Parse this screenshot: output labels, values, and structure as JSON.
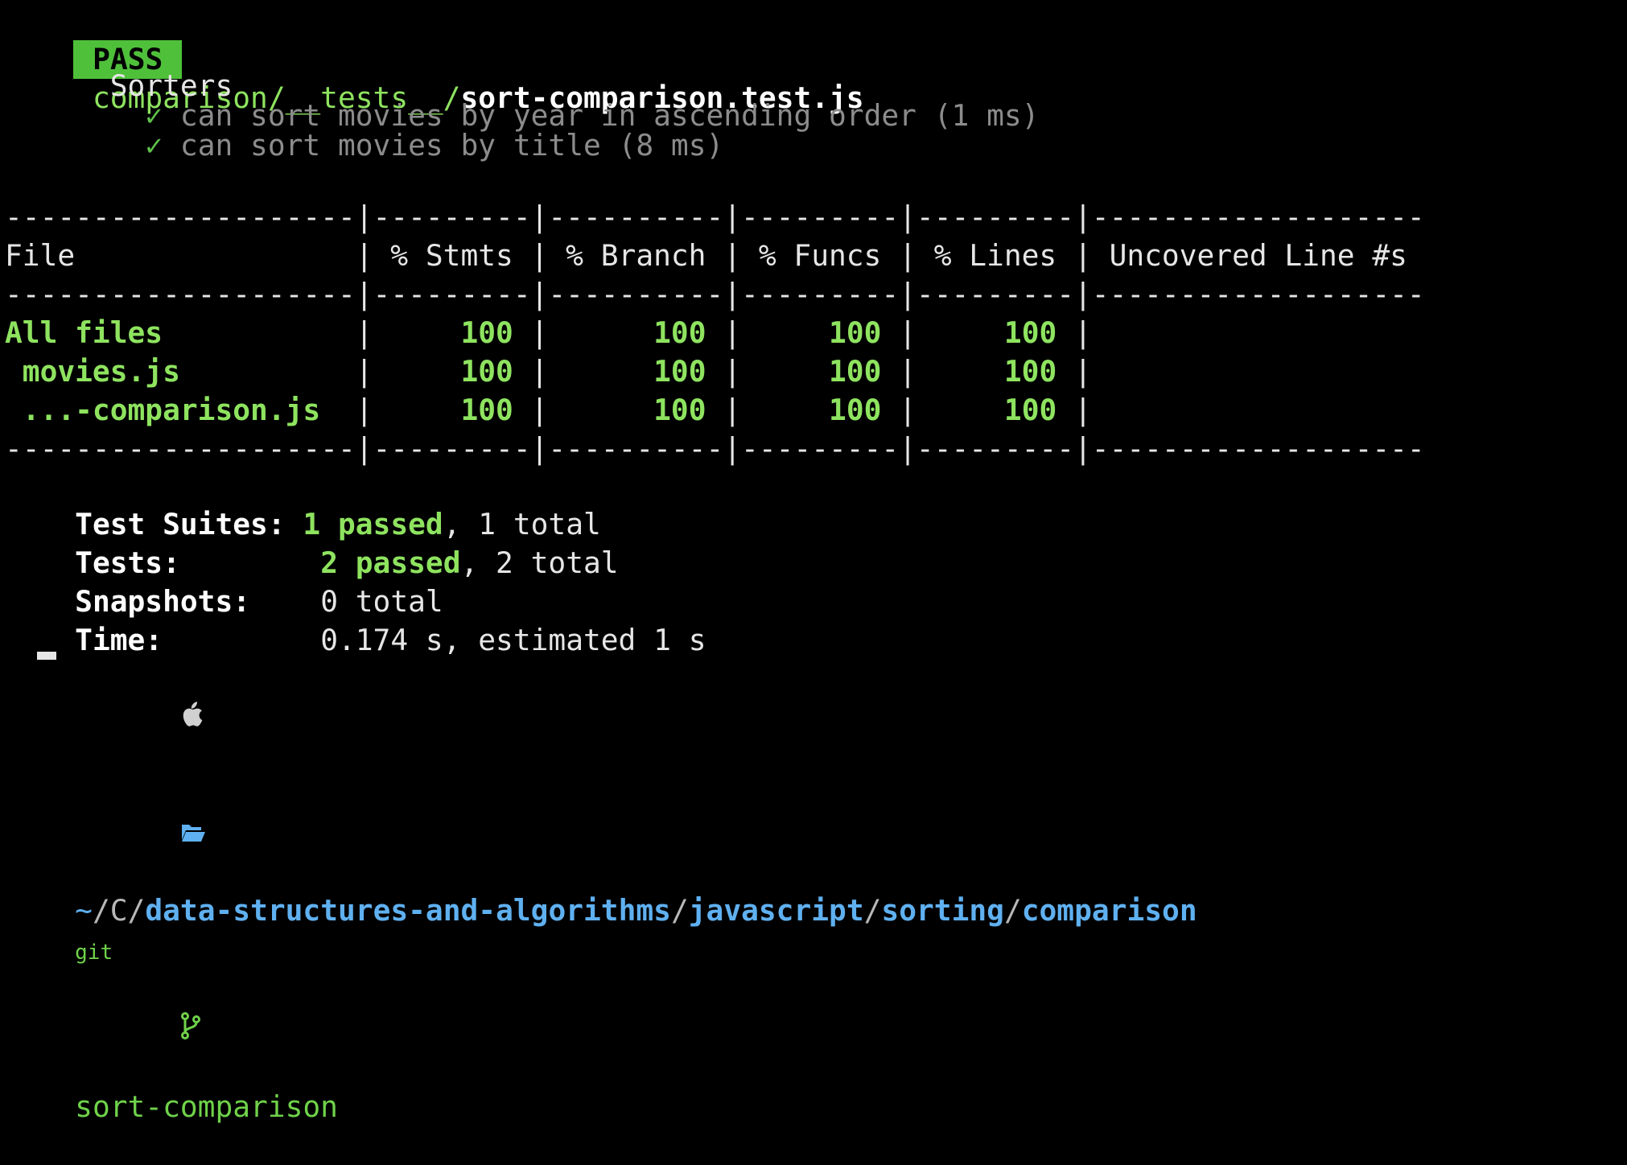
{
  "test_file": {
    "badge": "PASS",
    "dir": "comparison/__tests__/",
    "file": "sort-comparison.test.js"
  },
  "suite": {
    "name": "Sorters",
    "tests": [
      {
        "mark": "✓",
        "text": "can sort movies by year in ascending order (1 ms)"
      },
      {
        "mark": "✓",
        "text": "can sort movies by title (8 ms)"
      }
    ]
  },
  "coverage": {
    "separator": "--------------------|---------|----------|---------|---------|-------------------",
    "header": "File                | % Stmts | % Branch | % Funcs | % Lines | Uncovered Line #s ",
    "rows": [
      {
        "file": "All files",
        "cells": [
          "100",
          "100",
          "100",
          "100"
        ],
        "uncovered": ""
      },
      {
        "file": " movies.js",
        "cells": [
          "100",
          "100",
          "100",
          "100"
        ],
        "uncovered": ""
      },
      {
        "file": " ...-comparison.js",
        "cells": [
          "100",
          "100",
          "100",
          "100"
        ],
        "uncovered": ""
      }
    ]
  },
  "summary": {
    "suites_label": "Test Suites:",
    "suites_passed": "1 passed",
    "suites_total": ", 1 total",
    "tests_label": "Tests:",
    "tests_passed": "2 passed",
    "tests_total": ", 2 total",
    "snapshots_label": "Snapshots:",
    "snapshots_value": "0 total",
    "time_label": "Time:",
    "time_value": "0.174 s, estimated 1 s"
  },
  "prompt": {
    "os_icon": "apple-icon",
    "folder_icon": "folder-open-icon",
    "home": "~",
    "sep": "/",
    "c_dir": "C",
    "path_parts": [
      "data-structures-and-algorithms",
      "javascript",
      "sorting",
      "comparison"
    ],
    "git_label": "git",
    "branch_icon": "git-branch-icon",
    "branch": "sort-comparison"
  },
  "colors": {
    "background": "#000000",
    "pass_badge": "#4fc03a",
    "green": "#8ee35f",
    "path_blue": "#5fb0f0"
  }
}
